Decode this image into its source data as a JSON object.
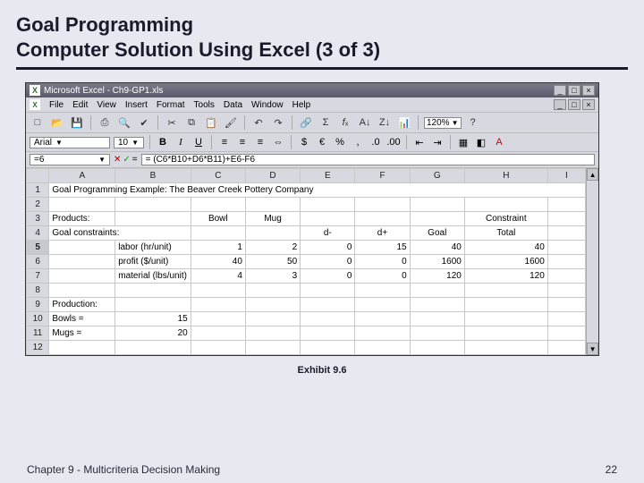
{
  "slide": {
    "title_line1": "Goal Programming",
    "title_line2": "Computer Solution Using Excel (3 of 3)",
    "exhibit_label": "Exhibit 9.6",
    "footer_left": "Chapter 9 - Multicriteria Decision Making",
    "footer_right": "22"
  },
  "excel": {
    "titlebar": "Microsoft Excel - Ch9-GP1.xls",
    "window_controls": {
      "min": "_",
      "max": "□",
      "close": "×"
    },
    "menu": [
      "File",
      "Edit",
      "View",
      "Insert",
      "Format",
      "Tools",
      "Data",
      "Window",
      "Help"
    ],
    "zoom": "120%",
    "font": "Arial",
    "font_size": "10",
    "name_box": "=6",
    "formula": "= (C6*B10+D6*B11)+E6-F6",
    "col_headers": [
      "A",
      "B",
      "C",
      "D",
      "E",
      "F",
      "G",
      "H",
      "I"
    ],
    "row_headers": [
      "1",
      "2",
      "3",
      "4",
      "5",
      "6",
      "7",
      "8",
      "9",
      "10",
      "11",
      "12"
    ],
    "active_row": "5",
    "cells": {
      "r1": {
        "A": "Goal Programming Example: The Beaver Creek Pottery Company"
      },
      "r3": {
        "A": "Products:",
        "C": "Bowl",
        "D": "Mug",
        "H": "Constraint"
      },
      "r4": {
        "A": "Goal constraints:",
        "E": "d-",
        "F": "d+",
        "G": "Goal",
        "H": "Total"
      },
      "r5": {
        "B": "labor (hr/unit)",
        "C": "1",
        "D": "2",
        "E": "0",
        "F": "15",
        "G": "40",
        "H": "40"
      },
      "r6": {
        "B": "profit ($/unit)",
        "C": "40",
        "D": "50",
        "E": "0",
        "F": "0",
        "G": "1600",
        "H": "1600"
      },
      "r7": {
        "B": "material (lbs/unit)",
        "C": "4",
        "D": "3",
        "E": "0",
        "F": "0",
        "G": "120",
        "H": "120"
      },
      "r9": {
        "A": "Production:"
      },
      "r10": {
        "A": "Bowls =",
        "B": "15"
      },
      "r11": {
        "A": "Mugs =",
        "B": "20"
      }
    }
  }
}
